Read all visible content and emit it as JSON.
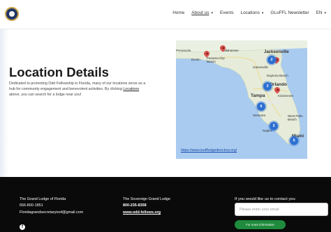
{
  "header": {
    "nav": [
      {
        "label": "Home",
        "caret": ""
      },
      {
        "label": "About us",
        "caret": "▾"
      },
      {
        "label": "Events",
        "caret": ""
      },
      {
        "label": "Locations",
        "caret": "▾"
      },
      {
        "label": "GLoFFL Newsletter",
        "caret": ""
      },
      {
        "label": "EN",
        "caret": "▾"
      }
    ]
  },
  "main": {
    "title": "Location Details",
    "intro_before": "Dedicated to promoting Odd Fellowship in Florida, many of our locations serve as a hub for community engagement and benevolent activities.  By clicking ",
    "intro_link": "Locations",
    "intro_after": " above, you can search for a lodge near you!"
  },
  "map": {
    "labels": {
      "pensacola": "Pensacola",
      "destin": "Destin",
      "panama": "Panama City Beach",
      "tallahassee": "Tallahassee",
      "jacksonville": "Jacksonville",
      "gainesville": "Gainesville",
      "daytona": "Daytona Beach",
      "tampa": "Tampa",
      "orlando": "Orlando",
      "florida": "FLORIDA",
      "kissimmee": "Kissimmee",
      "sarasota": "Sarasota",
      "west_palm": "West Palm Beach",
      "naples": "Naples",
      "miami": "Miami"
    },
    "clusters": [
      "2",
      "3",
      "6",
      "3",
      "5"
    ],
    "link": "https://www.ioofflodgedirectory.org/"
  },
  "footer": {
    "col1": {
      "name": "The Grand Lodge of Florida",
      "phone": "656-800-1851",
      "email": "Floridagrandsecretaryioof@gmail.com"
    },
    "col2": {
      "name": "The Sovereign Grand Lodge",
      "phone": "800-235-8358",
      "site": "www.odd-fellows.org"
    },
    "social_icon": "f",
    "contact_title": "If you would like us to contact you",
    "email_placeholder": "Please enter your email",
    "submit_label": "For more information"
  }
}
